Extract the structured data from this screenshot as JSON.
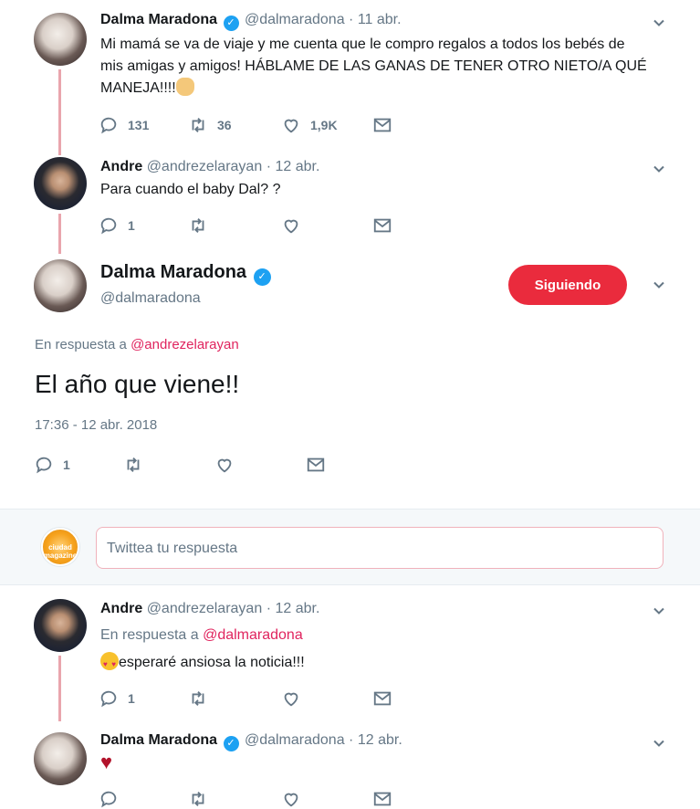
{
  "tweets": [
    {
      "name": "Dalma Maradona",
      "verified": true,
      "handle": "@dalmaradona",
      "date": "11 abr.",
      "text_line1": "Mi mamá se va de viaje y me cuenta que le compro regalos a todos los bebés de",
      "text_line2": "mis amigas y amigos! HÁBLAME DE LAS GANAS DE TENER OTRO NIETO/A QUÉ",
      "text_line3": "MANEJA!!!!",
      "replies": "131",
      "retweets": "36",
      "likes": "1,9K"
    },
    {
      "name": "Andre",
      "handle": "@andrezelarayan",
      "date": "12 abr.",
      "text": "Para cuando el baby Dal? ?",
      "replies": "1"
    }
  ],
  "focused_tweet": {
    "name": "Dalma Maradona",
    "verified": true,
    "handle": "@dalmaradona",
    "follow_button": "Siguiendo",
    "replying_prefix": "En respuesta a",
    "replying_to": "@andrezelarayan",
    "text": "El año que viene!!",
    "timestamp": "17:36 - 12 abr. 2018",
    "replies": "1"
  },
  "reply_composer": {
    "placeholder": "Twittea tu respuesta",
    "avatar_text": "ciudad magazine"
  },
  "replies": [
    {
      "name": "Andre",
      "handle": "@andrezelarayan",
      "date": "12 abr.",
      "replying_prefix": "En respuesta a",
      "replying_to": "@dalmaradona",
      "text": "esperaré ansiosa la noticia!!!",
      "replies": "1"
    },
    {
      "name": "Dalma Maradona",
      "verified": true,
      "handle": "@dalmaradona",
      "date": "12 abr."
    }
  ],
  "colors": {
    "accent_red": "#ea2b3d",
    "thread_line": "#e9a5ad",
    "muted": "#657786",
    "verified_blue": "#1da1f2"
  }
}
